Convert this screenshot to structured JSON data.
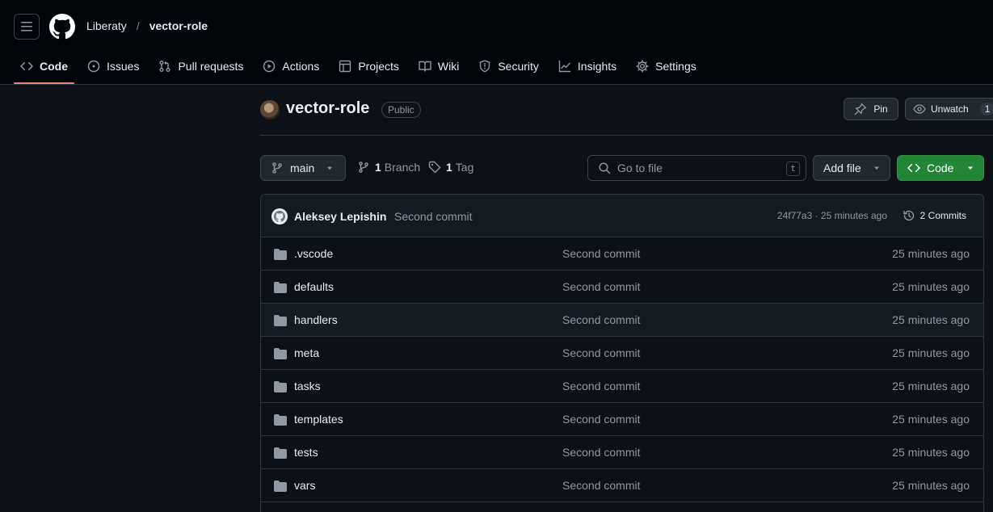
{
  "header": {
    "owner": "Liberaty",
    "separator": "/",
    "repo": "vector-role"
  },
  "nav": {
    "tabs": [
      {
        "label": "Code",
        "icon": "code-icon",
        "active": true
      },
      {
        "label": "Issues",
        "icon": "issue-icon"
      },
      {
        "label": "Pull requests",
        "icon": "pull-request-icon"
      },
      {
        "label": "Actions",
        "icon": "play-icon"
      },
      {
        "label": "Projects",
        "icon": "table-icon"
      },
      {
        "label": "Wiki",
        "icon": "book-icon"
      },
      {
        "label": "Security",
        "icon": "shield-icon"
      },
      {
        "label": "Insights",
        "icon": "graph-icon"
      },
      {
        "label": "Settings",
        "icon": "gear-icon"
      }
    ]
  },
  "repo": {
    "name": "vector-role",
    "visibility": "Public",
    "pin_label": "Pin",
    "watch_label": "Unwatch",
    "watch_count": "1"
  },
  "toolbar": {
    "branch": "main",
    "branch_count": "1",
    "branch_label": "Branch",
    "tag_count": "1",
    "tag_label": "Tag",
    "goto_placeholder": "Go to file",
    "goto_shortcut": "t",
    "add_file": "Add file",
    "code": "Code"
  },
  "commit": {
    "author": "Aleksey Lepishin",
    "message": "Second commit",
    "meta": "24f77a3 · 25 minutes ago",
    "count": "2 Commits"
  },
  "files": [
    {
      "name": ".vscode",
      "message": "Second commit",
      "age": "25 minutes ago"
    },
    {
      "name": "defaults",
      "message": "Second commit",
      "age": "25 minutes ago"
    },
    {
      "name": "handlers",
      "message": "Second commit",
      "age": "25 minutes ago"
    },
    {
      "name": "meta",
      "message": "Second commit",
      "age": "25 minutes ago"
    },
    {
      "name": "tasks",
      "message": "Second commit",
      "age": "25 minutes ago"
    },
    {
      "name": "templates",
      "message": "Second commit",
      "age": "25 minutes ago"
    },
    {
      "name": "tests",
      "message": "Second commit",
      "age": "25 minutes ago"
    },
    {
      "name": "vars",
      "message": "Second commit",
      "age": "25 minutes ago"
    }
  ],
  "colors": {
    "accent_underline": "#f78166",
    "code_button": "#238636",
    "background": "#0d1117"
  }
}
